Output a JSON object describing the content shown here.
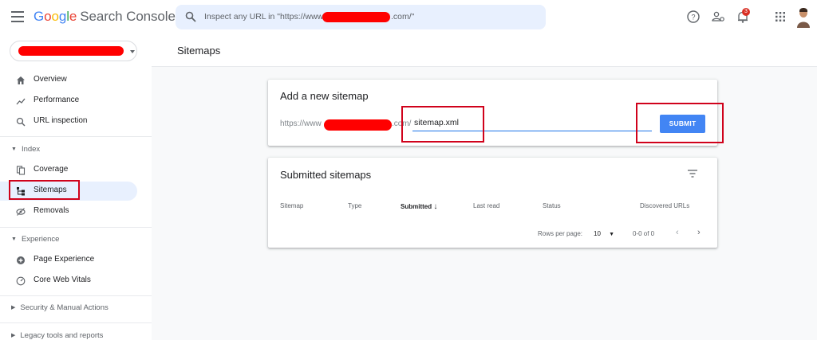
{
  "header": {
    "logo_letters": [
      "G",
      "o",
      "o",
      "g",
      "l",
      "e"
    ],
    "product": "Search Console",
    "search_prefix": "Inspect any URL in \"https://www",
    "search_suffix": ".com/\"",
    "notification_count": "3",
    "icons": [
      "menu-icon",
      "search-icon",
      "help-icon",
      "manage-users-icon",
      "notifications-icon",
      "apps-icon",
      "avatar"
    ]
  },
  "sidebar": {
    "nav": [
      {
        "label": "Overview",
        "icon": "home-icon"
      },
      {
        "label": "Performance",
        "icon": "trending-icon"
      },
      {
        "label": "URL inspection",
        "icon": "search-icon"
      }
    ],
    "index_label": "Index",
    "index_items": [
      {
        "label": "Coverage",
        "icon": "coverage-icon"
      },
      {
        "label": "Sitemaps",
        "icon": "sitemap-icon"
      },
      {
        "label": "Removals",
        "icon": "removals-icon"
      }
    ],
    "experience_label": "Experience",
    "experience_items": [
      {
        "label": "Page Experience",
        "icon": "page-experience-icon"
      },
      {
        "label": "Core Web Vitals",
        "icon": "gauge-icon"
      }
    ],
    "security_label": "Security & Manual Actions",
    "legacy_label": "Legacy tools and reports"
  },
  "main": {
    "title": "Sitemaps",
    "add_card": {
      "title": "Add a new sitemap",
      "url_prefix": "https://www",
      "url_suffix": ".com/",
      "input_value": "sitemap.xml",
      "submit_label": "SUBMIT"
    },
    "submitted_card": {
      "title": "Submitted sitemaps",
      "columns": [
        "Sitemap",
        "Type",
        "Submitted",
        "Last read",
        "Status",
        "Discovered URLs"
      ],
      "rows_per_page_label": "Rows per page:",
      "rows_per_page_value": "10",
      "range": "0-0 of 0"
    }
  },
  "colors": {
    "accent": "#1a73e8",
    "button": "#4285f4",
    "highlight_box": "#d0021b",
    "redaction": "#ff0000"
  }
}
